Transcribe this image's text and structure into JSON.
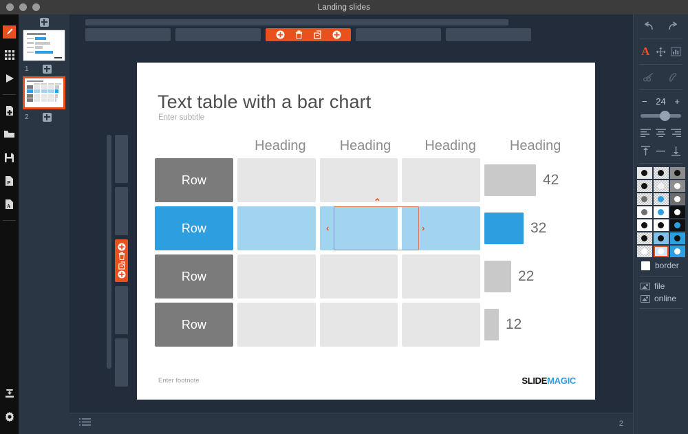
{
  "window": {
    "title": "Landing slides",
    "traffic_lights": [
      "close",
      "minimize",
      "zoom"
    ]
  },
  "left_rail": {
    "items": [
      {
        "name": "edit-mode",
        "icon": "pencil-icon",
        "active": true
      },
      {
        "name": "grid-view",
        "icon": "grid-icon",
        "active": false
      },
      {
        "name": "play-presentation",
        "icon": "play-icon",
        "active": false
      },
      {
        "name": "new-document",
        "icon": "new-file-icon",
        "active": false
      },
      {
        "name": "open-document",
        "icon": "folder-icon",
        "active": false
      },
      {
        "name": "save-document",
        "icon": "save-disk-icon",
        "active": false
      },
      {
        "name": "export-powerpoint",
        "icon": "file-ppt-icon",
        "active": false
      },
      {
        "name": "export-pdf",
        "icon": "file-pdf-icon",
        "active": false
      },
      {
        "name": "import",
        "icon": "import-icon",
        "active": false
      },
      {
        "name": "settings",
        "icon": "gear-icon",
        "active": false
      }
    ]
  },
  "thumbnails": {
    "add_slide_icon": "add-slide-icon",
    "slides": [
      {
        "number": "1",
        "selected": false
      },
      {
        "number": "2",
        "selected": true
      }
    ]
  },
  "top_toolbar": {
    "column_bar_label": "",
    "chips": [
      "",
      "",
      "",
      "",
      ""
    ],
    "active_chip_index": 2,
    "actions": [
      {
        "name": "add-column-left",
        "icon": "plus-circle-icon"
      },
      {
        "name": "delete-column",
        "icon": "trash-icon"
      },
      {
        "name": "duplicate-column",
        "icon": "duplicate-icon"
      },
      {
        "name": "add-column-right",
        "icon": "plus-circle-icon"
      }
    ]
  },
  "left_toolbar": {
    "active_chip_index": 2,
    "actions": [
      {
        "name": "add-row-above",
        "icon": "plus-circle-icon"
      },
      {
        "name": "delete-row",
        "icon": "trash-icon"
      },
      {
        "name": "duplicate-row",
        "icon": "duplicate-icon"
      },
      {
        "name": "add-row-below",
        "icon": "plus-circle-icon"
      }
    ]
  },
  "slide": {
    "title": "Text table with a bar chart",
    "subtitle": "Enter subtitle",
    "footnote": "Enter footnote",
    "logo": {
      "part1": "SLIDE",
      "part2": "MAGIC"
    }
  },
  "chart_data": {
    "type": "table",
    "title": "Text table with a bar chart",
    "columns": [
      "",
      "Heading",
      "Heading",
      "Heading",
      "Heading"
    ],
    "rows": [
      {
        "label": "Row",
        "cells": [
          "",
          "",
          ""
        ],
        "bar_value": 42,
        "highlighted": false
      },
      {
        "label": "Row",
        "cells": [
          "",
          "",
          ""
        ],
        "bar_value": 32,
        "highlighted": true
      },
      {
        "label": "Row",
        "cells": [
          "",
          "",
          ""
        ],
        "bar_value": 22,
        "highlighted": false
      },
      {
        "label": "Row",
        "cells": [
          "",
          "",
          ""
        ],
        "bar_value": 12,
        "highlighted": false
      }
    ],
    "bar_max": 42,
    "colors": {
      "label_default": "#7b7b7b",
      "label_highlight": "#2d9fe0",
      "cell_default": "#e6e6e6",
      "cell_highlight": "#a2d4f0",
      "bar_default": "#c9c9c9",
      "bar_highlight": "#2d9fe0",
      "selection": "#dd7a52"
    },
    "selected_cell": {
      "row": 2,
      "column": 3
    }
  },
  "bottom_bar": {
    "list_icon": "bulleted-list-icon",
    "page_number": "2"
  },
  "right_panel": {
    "history": [
      {
        "name": "undo-button",
        "icon": "undo-arrow-icon"
      },
      {
        "name": "redo-button",
        "icon": "redo-arrow-icon"
      }
    ],
    "tools": [
      {
        "name": "text-tool",
        "icon": "letter-a-icon",
        "active": true
      },
      {
        "name": "move-tool",
        "icon": "move-arrows-icon",
        "active": false
      },
      {
        "name": "chart-tool",
        "icon": "bar-chart-icon",
        "active": false
      }
    ],
    "tools2": [
      {
        "name": "scissors-tool",
        "icon": "scissors-icon",
        "disabled": true
      },
      {
        "name": "paint-tool",
        "icon": "paint-icon",
        "disabled": true
      }
    ],
    "font_size": {
      "decrease": "−",
      "value": "24",
      "increase": "+"
    },
    "align": [
      {
        "name": "align-left",
        "icon": "align-left-icon"
      },
      {
        "name": "align-center",
        "icon": "align-center-icon"
      },
      {
        "name": "align-right",
        "icon": "align-right-icon"
      },
      {
        "name": "align-top",
        "icon": "align-top-icon"
      },
      {
        "name": "align-middle",
        "icon": "align-middle-icon"
      },
      {
        "name": "align-bottom",
        "icon": "align-bottom-icon"
      }
    ],
    "swatches": [
      {
        "bg": "#e8e8e8",
        "dot": "#111111",
        "checker": false,
        "selected": false
      },
      {
        "bg": "#c9c9c9",
        "dot": "#111111",
        "checker": true,
        "selected": false
      },
      {
        "bg": "#8d8d8d",
        "dot": "#111111",
        "checker": false,
        "selected": false
      },
      {
        "bg": "#c9c9c9",
        "dot": "#111111",
        "checker": true,
        "selected": false
      },
      {
        "bg": "#c9c9c9",
        "dot": "#f2f2f2",
        "checker": true,
        "selected": false
      },
      {
        "bg": "#8d8d8d",
        "dot": "#ffffff",
        "checker": false,
        "selected": false
      },
      {
        "bg": "#c9c9c9",
        "dot": "#6e6e6e",
        "checker": true,
        "selected": false
      },
      {
        "bg": "#c9c9c9",
        "dot": "#2d9fe0",
        "checker": true,
        "selected": false
      },
      {
        "bg": "#6d6d6d",
        "dot": "#ffffff",
        "checker": false,
        "selected": false
      },
      {
        "bg": "#ffffff",
        "dot": "#6e6e6e",
        "checker": false,
        "selected": false
      },
      {
        "bg": "#ffffff",
        "dot": "#2d9fe0",
        "checker": false,
        "selected": false
      },
      {
        "bg": "#111111",
        "dot": "#ffffff",
        "checker": false,
        "selected": false
      },
      {
        "bg": "#ffffff",
        "dot": "#111111",
        "checker": false,
        "selected": false
      },
      {
        "bg": "#ffffff",
        "dot": "#111111",
        "checker": false,
        "selected": false
      },
      {
        "bg": "#111111",
        "dot": "#2d9fe0",
        "checker": false,
        "selected": false
      },
      {
        "bg": "#8d8d8d",
        "dot": "#111111",
        "checker": true,
        "selected": false
      },
      {
        "bg": "#7fc3ea",
        "dot": "#111111",
        "checker": false,
        "selected": false
      },
      {
        "bg": "#2d9fe0",
        "dot": "#111111",
        "checker": false,
        "selected": false
      },
      {
        "bg": "#8d8d8d",
        "dot": "#ffffff",
        "checker": true,
        "selected": false
      },
      {
        "bg": "#cfe9f8",
        "dot": "#ffffff",
        "checker": false,
        "selected": true
      },
      {
        "bg": "#2d9fe0",
        "dot": "#ffffff",
        "checker": false,
        "selected": false
      }
    ],
    "border": {
      "label": "border",
      "checked": false
    },
    "image_sources": [
      {
        "name": "image-from-file",
        "label": "file",
        "icon": "image-icon"
      },
      {
        "name": "image-from-online",
        "label": "online",
        "icon": "image-icon"
      }
    ]
  }
}
